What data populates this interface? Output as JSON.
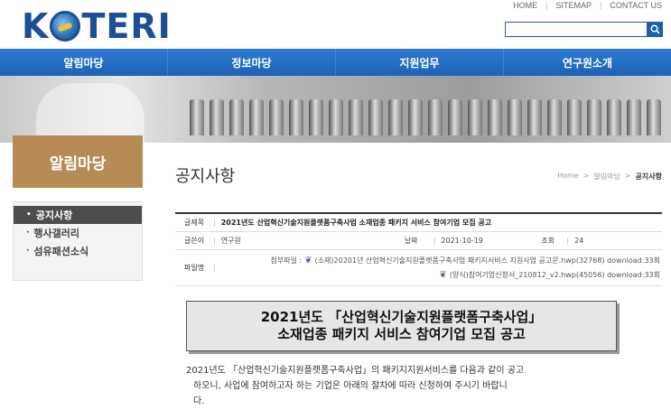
{
  "header": {
    "logo_k": "K",
    "logo_rest": "TERI",
    "links": [
      "HOME",
      "SITEMAP",
      "CONTACT US"
    ],
    "search_placeholder": ""
  },
  "nav": [
    "알림마당",
    "정보마당",
    "지원업무",
    "연구원소개"
  ],
  "sidebar": {
    "title": "알림마당",
    "items": [
      {
        "label": "공지사항",
        "active": true
      },
      {
        "label": "행사갤러리",
        "active": false
      },
      {
        "label": "섬유패션소식",
        "active": false
      }
    ]
  },
  "main": {
    "title": "공지사항",
    "breadcrumb": [
      "Home",
      ">",
      "알림마당",
      ">",
      "공지사항"
    ]
  },
  "board": {
    "title_label": "글제목",
    "title_value": "2021년도 산업혁신기술지원플랫폼구축사업 소재업종 패키지 서비스 참여기업 모집 공고",
    "author_label": "글쓴이",
    "author_value": "연구원",
    "date_label": "날짜",
    "date_value": "2021-10-19",
    "views_label": "조회",
    "views_value": "24",
    "files_label": "파일명",
    "files_prefix": "첨부파일 :",
    "files": [
      "(소재)20201년 산업혁신기술지원플랫폼구축사업 패키지서비스 지원사업 공고문.hwp(32768) download:33회",
      "(양식)참여기업신청서_210812_v2.hwp(45056) download:33회"
    ]
  },
  "notice": {
    "line1": "2021년도 「산업혁신기술지원플랫폼구축사업」",
    "line2": "소재업종 패키지 서비스 참여기업 모집 공고"
  },
  "body": {
    "line1": "2021년도 「산업혁신기술지원플랫폼구축사업」의 패키지지원서비스를 다음과 같이 공고",
    "line2": "하오니, 사업에 참여하고자 하는 기업은 아래의 절차에 따라 신청하여 주시기 바랍니",
    "line3": "다."
  },
  "colors": {
    "brand": "#1b4f97",
    "nav": "#1d63b6",
    "sidebar_title": "#b78b56",
    "sidebar_active": "#4d4d4d"
  }
}
